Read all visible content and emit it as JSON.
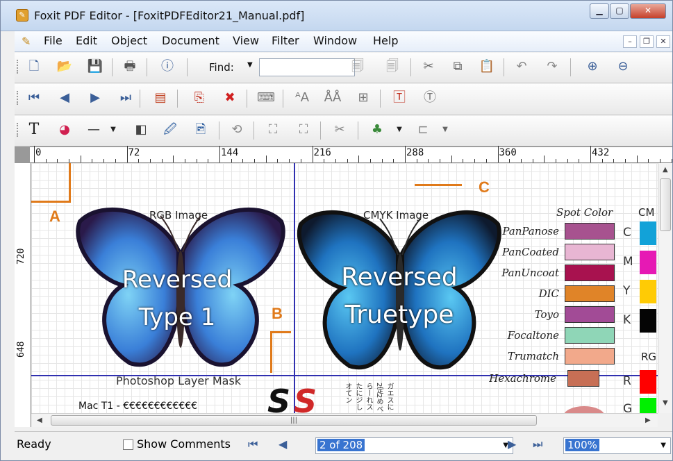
{
  "window": {
    "title": "Foxit PDF Editor - [FoxitPDFEditor21_Manual.pdf]"
  },
  "menu": [
    "File",
    "Edit",
    "Object",
    "Document",
    "View",
    "Filter",
    "Window",
    "Help"
  ],
  "toolbar": {
    "find_label": "Find:",
    "find_value": ""
  },
  "ruler": {
    "h_labels": [
      "0",
      "72",
      "144",
      "216",
      "288",
      "360",
      "432"
    ],
    "v_labels": [
      "720",
      "648"
    ]
  },
  "page": {
    "callouts": {
      "a": "A",
      "b": "B",
      "c": "C"
    },
    "rgb_label": "RGB Image",
    "cmyk_label": "CMYK Image",
    "rgb_text_1": "Reversed",
    "rgb_text_2": "Type 1",
    "cmyk_text_1": "Reversed",
    "cmyk_text_2": "Truetype",
    "mask_label": "Photoshop Layer Mask",
    "mac_label": "Mac T1 - €€€€€€€€€€€€",
    "spot_title": "Spot Color",
    "cmyk_title": "CM",
    "rgb_title": "RG",
    "spots": [
      {
        "label": "PanPanose",
        "color": "#a7528f"
      },
      {
        "label": "PanCoated",
        "color": "#e8b6d3"
      },
      {
        "label": "PanUncoat",
        "color": "#a8124f"
      },
      {
        "label": "DIC",
        "color": "#e08428"
      },
      {
        "label": "Toyo",
        "color": "#a24b96"
      },
      {
        "label": "Focaltone",
        "color": "#8fd6b7"
      },
      {
        "label": "Trumatch",
        "color": "#f2a98b"
      },
      {
        "label": "Hexachrome",
        "color": "#c76f55"
      }
    ],
    "cmyk_swatches": [
      {
        "label": "C",
        "color": "#12a2d8"
      },
      {
        "label": "M",
        "color": "#e619b4"
      },
      {
        "label": "Y",
        "color": "#ffcb05"
      },
      {
        "label": "K",
        "color": "#050505"
      }
    ],
    "rgb_swatches": [
      {
        "label": "R",
        "color": "#ff0000"
      },
      {
        "label": "G",
        "color": "#00f000"
      }
    ],
    "japanese_cols": [
      "ガエ",
      "スに",
      "2定",
      "2め",
      "ベら",
      "ーれ",
      "スた",
      "にジ",
      "しオ",
      "てン"
    ]
  },
  "status": {
    "ready": "Ready",
    "show_comments": "Show Comments",
    "page_value": "2 of 208",
    "zoom_value": "100%"
  }
}
